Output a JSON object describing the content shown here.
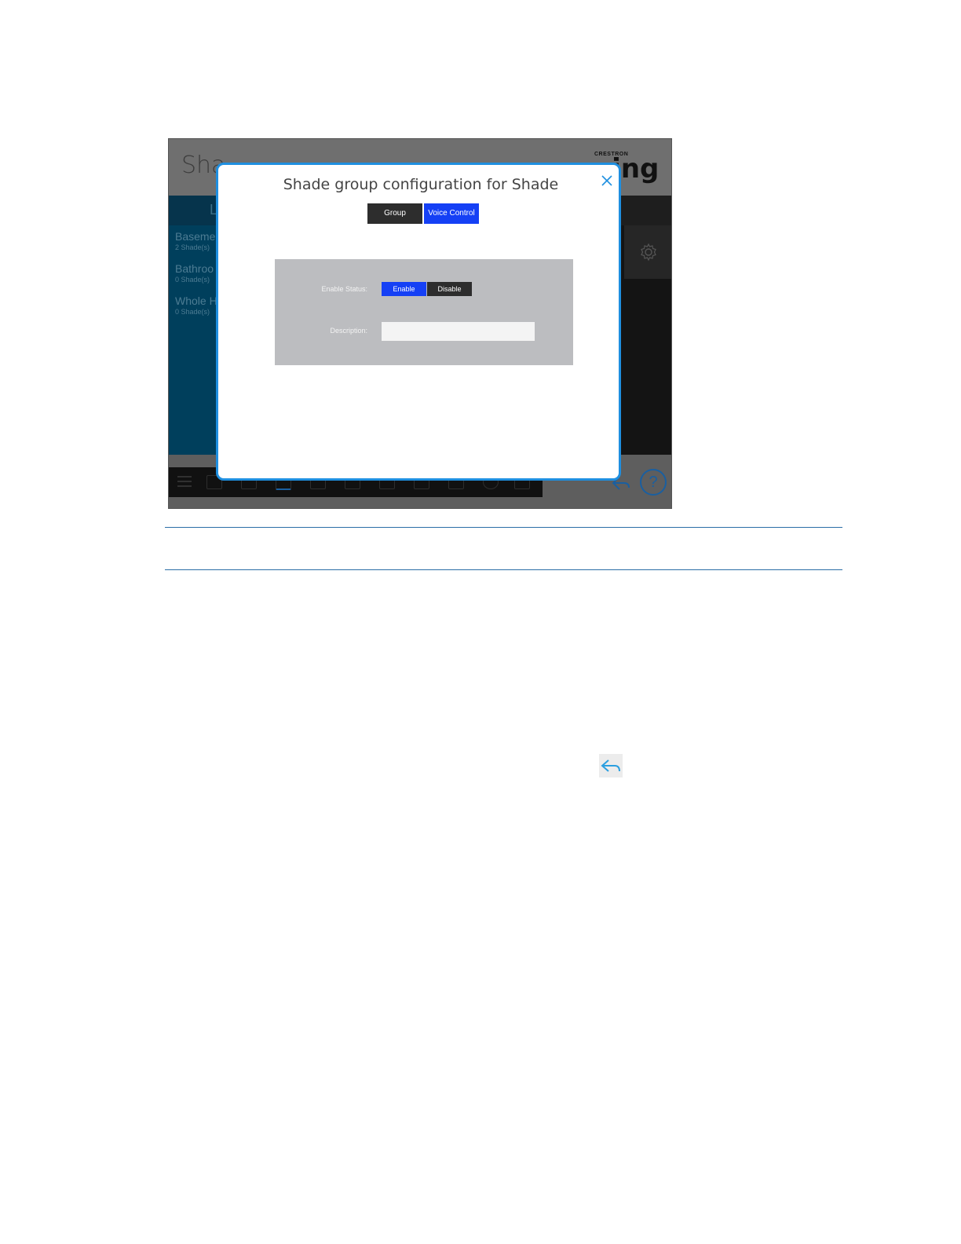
{
  "app": {
    "title": "Shade Groups",
    "title_visible": "Sha",
    "brand_small": "CRESTRON",
    "brand_big": "ying",
    "left_tab_char": "L",
    "rooms": [
      {
        "name": "Baseme",
        "count": "2 Shade(s)"
      },
      {
        "name": "Bathroo",
        "count": "0 Shade(s)"
      },
      {
        "name": "Whole H",
        "count": "0 Shade(s)"
      }
    ]
  },
  "modal": {
    "title": "Shade group configuration for Shade",
    "tabs": [
      {
        "label": "Group",
        "selected": false
      },
      {
        "label": "Voice Control",
        "selected": true
      }
    ],
    "form": {
      "enable_status_label": "Enable Status:",
      "enable_label": "Enable",
      "disable_label": "Disable",
      "enable_selected": true,
      "description_label": "Description:",
      "description_value": ""
    }
  },
  "colors": {
    "accent_blue": "#1540f5",
    "modal_border": "#1f8fe0",
    "dark_button": "#2d2d2d",
    "panel_gray": "#bcbdc0",
    "left_panel": "#003f5c"
  },
  "icons": [
    "close-icon",
    "gear-icon",
    "menu-icon",
    "back-arrow-icon",
    "help-icon"
  ]
}
